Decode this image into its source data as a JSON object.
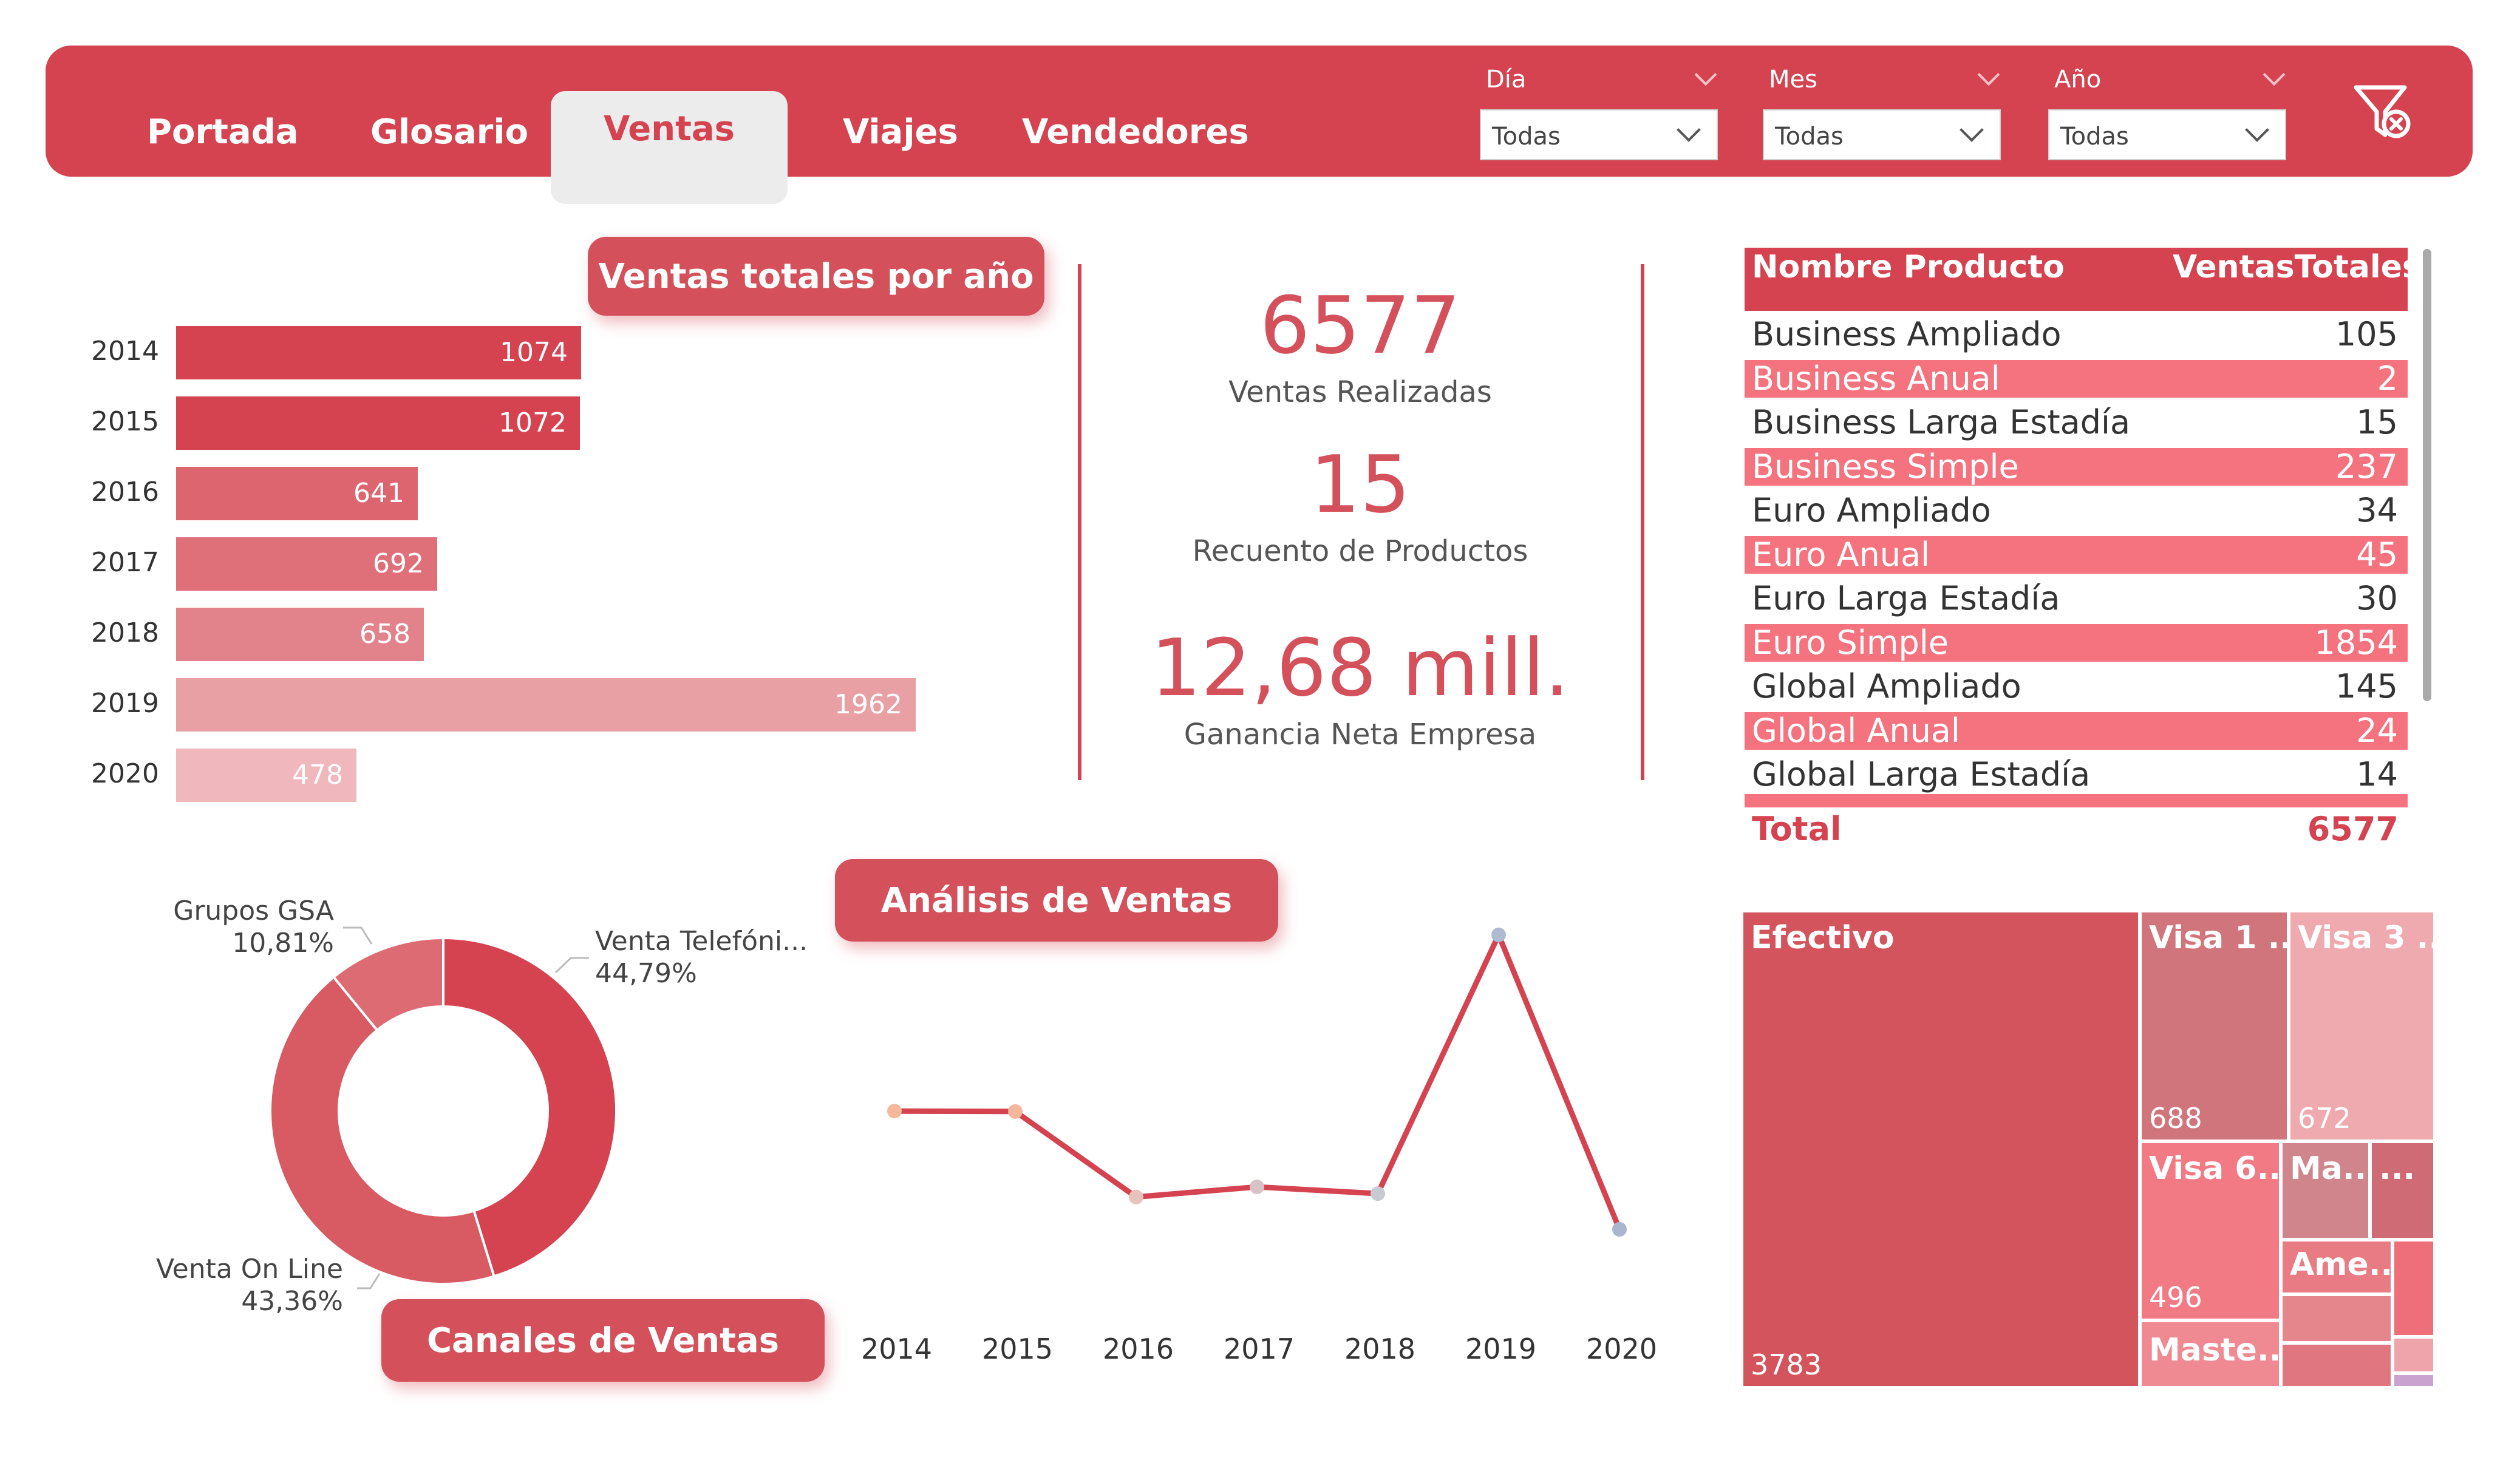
{
  "nav": {
    "tabs": [
      "Portada",
      "Glosario",
      "Ventas",
      "Viajes",
      "Vendedores"
    ],
    "active": "Ventas"
  },
  "filters": [
    {
      "label": "Día",
      "value": "Todas"
    },
    {
      "label": "Mes",
      "value": "Todas"
    },
    {
      "label": "Año",
      "value": "Todas"
    }
  ],
  "sections": {
    "ventas_por_anio": "Ventas totales por año",
    "analisis": "Análisis de Ventas",
    "canales": "Canales de Ventas"
  },
  "kpis": [
    {
      "value": "6577",
      "label": "Ventas Realizadas"
    },
    {
      "value": "15",
      "label": "Recuento de Productos"
    },
    {
      "value": "12,68 mill.",
      "label": "Ganancia Neta Empresa"
    }
  ],
  "table": {
    "headers": [
      "Nombre Producto",
      "VentasTotales"
    ],
    "rows": [
      [
        "Business Ampliado",
        "105"
      ],
      [
        "Business Anual",
        "2"
      ],
      [
        "Business Larga Estadía",
        "15"
      ],
      [
        "Business Simple",
        "237"
      ],
      [
        "Euro Ampliado",
        "34"
      ],
      [
        "Euro Anual",
        "45"
      ],
      [
        "Euro Larga Estadía",
        "30"
      ],
      [
        "Euro Simple",
        "1854"
      ],
      [
        "Global Ampliado",
        "145"
      ],
      [
        "Global Anual",
        "24"
      ],
      [
        "Global Larga Estadía",
        "14"
      ]
    ],
    "total_label": "Total",
    "total_value": "6577"
  },
  "treemap": [
    {
      "label": "Efectivo",
      "value": "3783"
    },
    {
      "label": "Visa 1 ...",
      "value": "688"
    },
    {
      "label": "Visa 3 ...",
      "value": "672"
    },
    {
      "label": "Visa 6...",
      "value": "496"
    },
    {
      "label": "Ma...",
      "value": ""
    },
    {
      "label": "...",
      "value": ""
    },
    {
      "label": "Ame...",
      "value": ""
    },
    {
      "label": "Maste...",
      "value": ""
    }
  ],
  "colors": {
    "accent": "#d4434f",
    "light_bg": "#ececec"
  },
  "icons": {
    "clear_filters": "filter-clear-icon"
  },
  "chart_data": [
    {
      "type": "bar",
      "orientation": "horizontal",
      "title": "Ventas totales por año",
      "categories": [
        "2014",
        "2015",
        "2016",
        "2017",
        "2018",
        "2019",
        "2020"
      ],
      "values": [
        1074,
        1072,
        641,
        692,
        658,
        1962,
        478
      ]
    },
    {
      "type": "pie",
      "style": "donut",
      "title": "Canales de Ventas",
      "slices": [
        {
          "name": "Venta Telefóni...",
          "value": 44.79,
          "label": "44,79%"
        },
        {
          "name": "Venta On Line",
          "value": 43.36,
          "label": "43,36%"
        },
        {
          "name": "Grupos GSA",
          "value": 10.81,
          "label": "10,81%"
        }
      ]
    },
    {
      "type": "line",
      "title": "Análisis de Ventas",
      "x": [
        "2014",
        "2015",
        "2016",
        "2017",
        "2018",
        "2019",
        "2020"
      ],
      "values": [
        1074,
        1072,
        641,
        692,
        658,
        1962,
        478
      ]
    }
  ]
}
